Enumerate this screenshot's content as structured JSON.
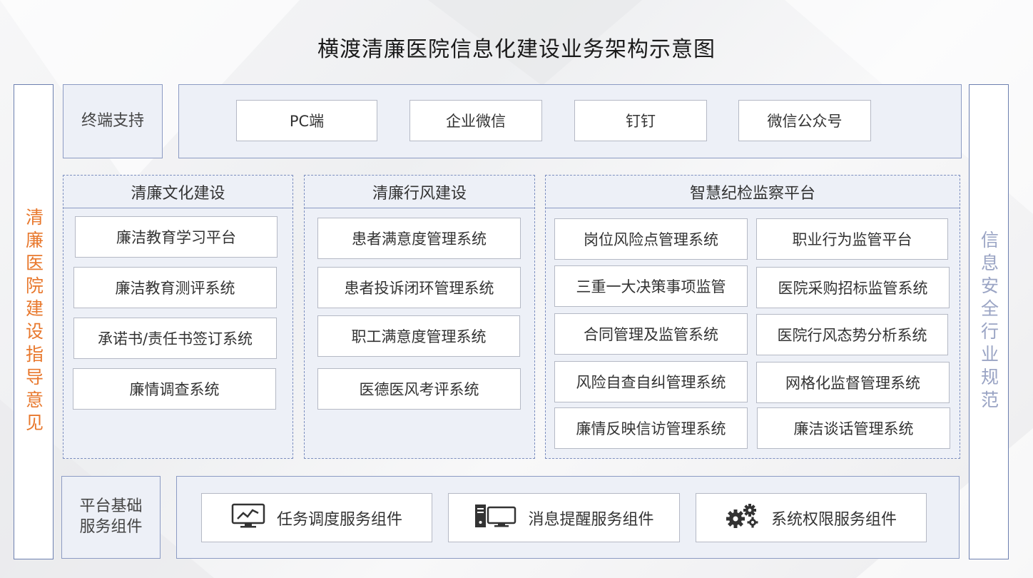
{
  "title": "横渡清廉医院信息化建设业务架构示意图",
  "left_sidebar": "清廉医院建设指导意见",
  "right_sidebar": "信息安全行业规范",
  "terminal": {
    "label": "终端支持",
    "items": [
      "PC端",
      "企业微信",
      "钉钉",
      "微信公众号"
    ]
  },
  "sections": [
    {
      "title": "清廉文化建设",
      "items": [
        "廉洁教育学习平台",
        "廉洁教育测评系统",
        "承诺书/责任书签订系统",
        "廉情调查系统"
      ]
    },
    {
      "title": "清廉行风建设",
      "items": [
        "患者满意度管理系统",
        "患者投诉闭环管理系统",
        "职工满意度管理系统",
        "医德医风考评系统"
      ]
    },
    {
      "title": "智慧纪检监察平台",
      "left_items": [
        "岗位风险点管理系统",
        "三重一大决策事项监管",
        "合同管理及监管系统",
        "风险自查自纠管理系统",
        "廉情反映信访管理系统"
      ],
      "right_items": [
        "职业行为监管平台",
        "医院采购招标监管系统",
        "医院行风态势分析系统",
        "网格化监督管理系统",
        "廉洁谈话管理系统"
      ]
    }
  ],
  "platform": {
    "label": "平台基础服务组件",
    "label_line1": "平台基础",
    "label_line2": "服务组件",
    "services": [
      {
        "label": "任务调度服务组件",
        "icon": "monitor-chart-icon"
      },
      {
        "label": "消息提醒服务组件",
        "icon": "server-monitor-icon"
      },
      {
        "label": "系统权限服务组件",
        "icon": "gears-icon"
      }
    ]
  },
  "colors": {
    "accent_orange": "#e8782d",
    "side_blue_gray": "#9aa4c4",
    "panel_bg": "#edf0f7",
    "border_blue": "#8c9bc3"
  }
}
